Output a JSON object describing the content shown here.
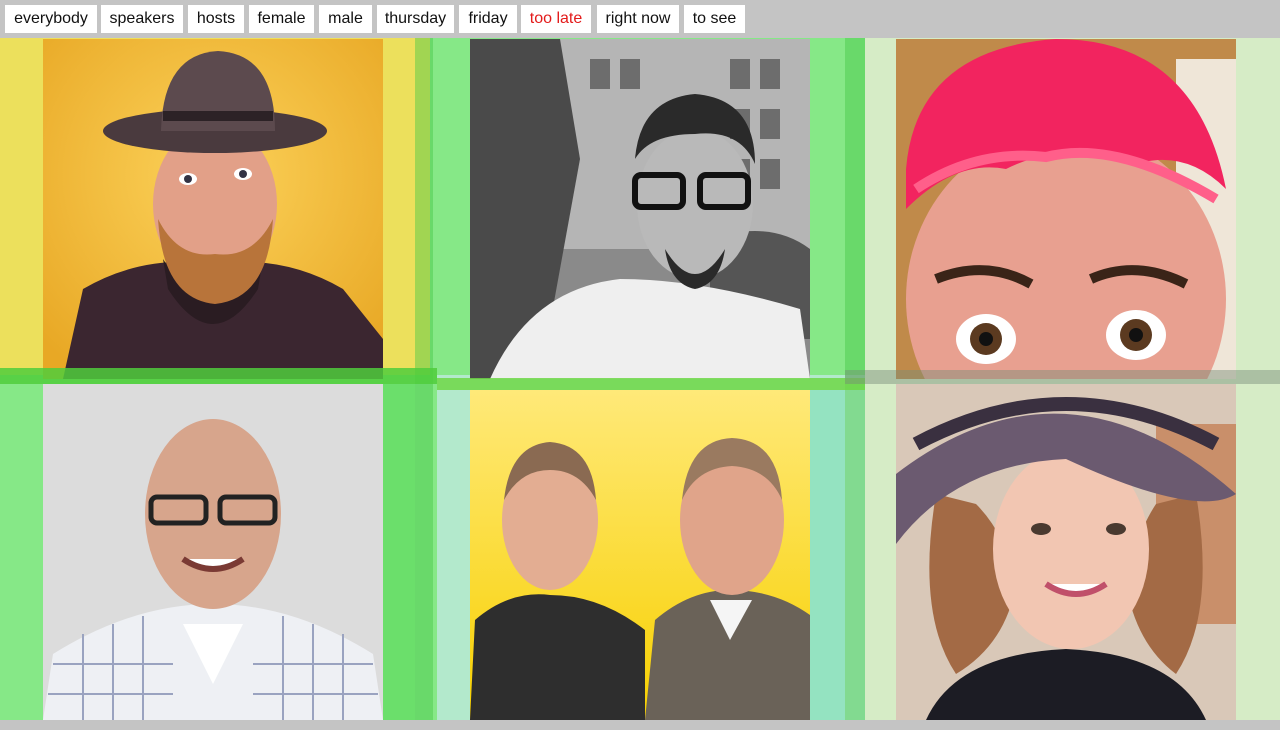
{
  "filters": [
    {
      "label": "everybody",
      "active": false
    },
    {
      "label": "speakers",
      "active": false
    },
    {
      "label": "hosts",
      "active": false
    },
    {
      "label": "female",
      "active": false
    },
    {
      "label": "male",
      "active": false
    },
    {
      "label": "thursday",
      "active": false
    },
    {
      "label": "friday",
      "active": false
    },
    {
      "label": "too late",
      "active": true
    },
    {
      "label": "right now",
      "active": false
    },
    {
      "label": "to see",
      "active": false
    }
  ],
  "colors": {
    "bar_bg": "#c4c4c4",
    "active_text": "#e31b1b",
    "yellow_tile": "#ece05c",
    "green_tile": "#86e887",
    "mint_tile": "#b3e9cc",
    "pale_green_tile": "#d6ecc6"
  },
  "people": [
    {
      "icon": "person-with-brown-hat-icon"
    },
    {
      "icon": "person-with-glasses-bw-icon"
    },
    {
      "icon": "person-with-pink-hair-icon"
    },
    {
      "icon": "bald-person-with-glasses-icon"
    },
    {
      "icon": "two-people-icon"
    },
    {
      "icon": "person-with-sun-hat-icon"
    }
  ]
}
